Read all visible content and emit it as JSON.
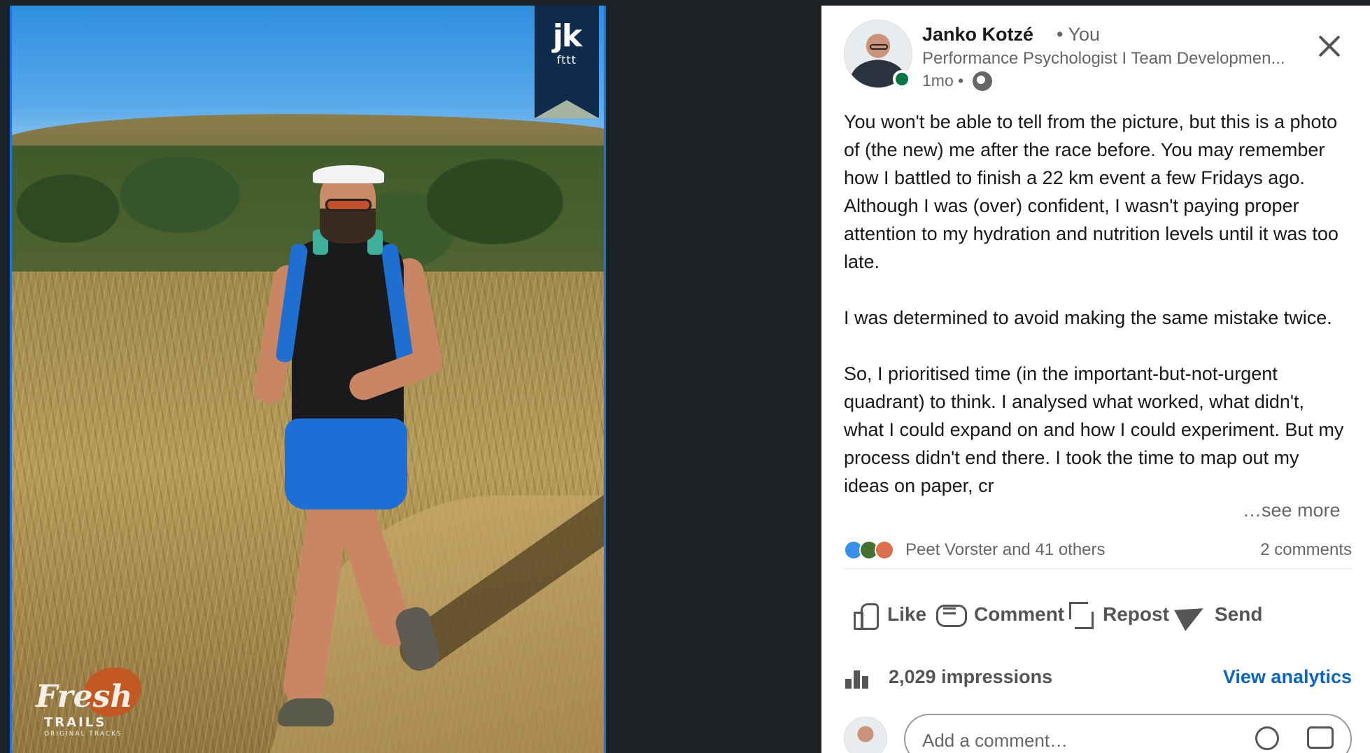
{
  "photo": {
    "ribbon_logo": "jk",
    "ribbon_sub": "fttt",
    "brand_fresh": "Fresh",
    "brand_trails": "TRAILS",
    "brand_sub": "ORIGINAL TRACKS"
  },
  "post": {
    "author": {
      "name": "Janko Kotzé",
      "relation": "• You",
      "headline": "Performance Psychologist I Team Developmen...",
      "time": "1mo •"
    },
    "body": [
      "You won't be able to tell from the picture, but this is a photo of (the new) me after the race before. You may remember how I battled to finish a 22 km event a few Fridays ago. Although I was (over) confident, I wasn't paying proper attention to my hydration and nutrition levels until it was too late.",
      "I was determined to avoid making the same mistake twice.",
      "So, I prioritised time (in the important-but-not-urgent quadrant) to think. I analysed what worked, what didn't, what I could expand on and how I could experiment. But my process didn't end there. I took the time to map out my ideas on paper, cr"
    ],
    "see_more": "…see more",
    "reactions_text": "Peet Vorster and 41 others",
    "comments_count": "2 comments"
  },
  "actions": {
    "like": "Like",
    "comment": "Comment",
    "repost": "Repost",
    "send": "Send"
  },
  "analytics": {
    "impressions": "2,029 impressions",
    "view_label": "View analytics"
  },
  "comment_box": {
    "placeholder": "Add a comment…"
  },
  "colors": {
    "accent": "#0a66c2",
    "online": "#057642",
    "backdrop": "#1d2226"
  },
  "icons": [
    "close-icon",
    "globe-icon",
    "like-icon",
    "comment-icon",
    "repost-icon",
    "send-icon",
    "bar-chart-icon",
    "emoji-icon",
    "image-icon"
  ]
}
